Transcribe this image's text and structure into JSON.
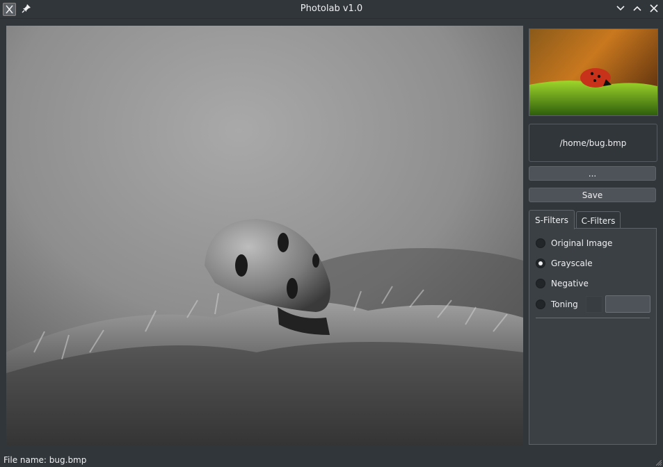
{
  "window": {
    "title": "Photolab v1.0",
    "icons": [
      "app-icon",
      "pin-icon",
      "minimize-icon",
      "maximize-icon",
      "close-icon"
    ]
  },
  "viewer": {
    "image_description": "grayscale ladybug on moss",
    "mode": "grayscale"
  },
  "thumbnail": {
    "image_description": "original color ladybug on moss"
  },
  "file_path": "/home/bug.bmp",
  "buttons": {
    "browse_label": "...",
    "save_label": "Save"
  },
  "tabs": [
    {
      "label": "S-Filters",
      "active": true
    },
    {
      "label": "C-Filters",
      "active": false
    }
  ],
  "filters": [
    {
      "label": "Original Image",
      "checked": false
    },
    {
      "label": "Grayscale",
      "checked": true
    },
    {
      "label": "Negative",
      "checked": false
    },
    {
      "label": "Toning",
      "checked": false
    }
  ],
  "status": {
    "text": "File name: bug.bmp"
  },
  "colors": {
    "window_bg": "#31363b",
    "panel_bg": "#3b4045",
    "button_bg": "#4d5359",
    "text": "#eff0f1"
  }
}
